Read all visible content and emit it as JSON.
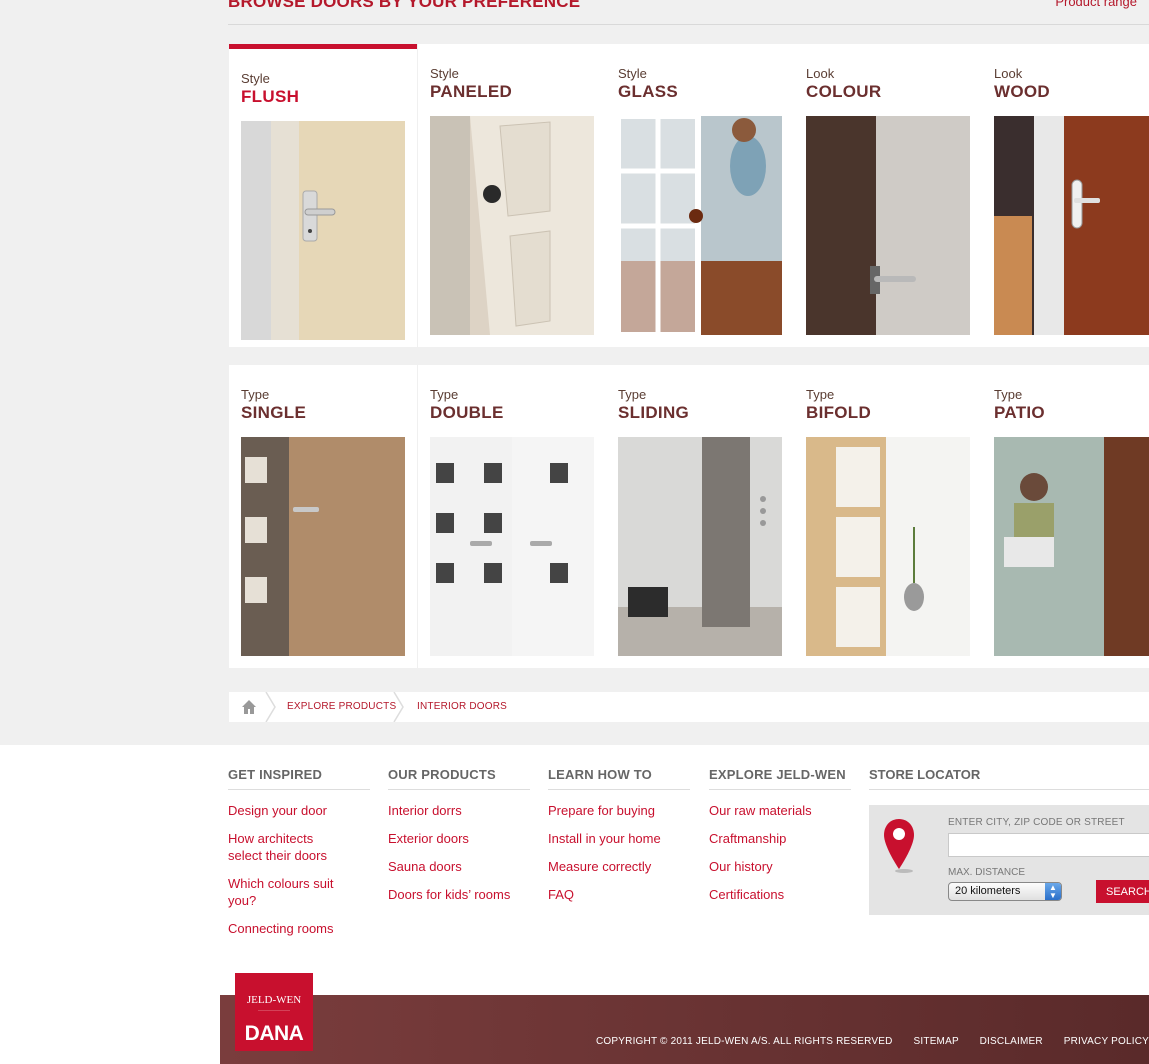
{
  "header": {
    "title": "BROWSE DOORS BY YOUR PREFERENCE",
    "product_range": "Product range"
  },
  "cards": [
    {
      "kicker": "Style",
      "label": "FLUSH"
    },
    {
      "kicker": "Style",
      "label": "PANELED"
    },
    {
      "kicker": "Style",
      "label": "GLASS"
    },
    {
      "kicker": "Look",
      "label": "COLOUR"
    },
    {
      "kicker": "Look",
      "label": "WOOD"
    },
    {
      "kicker": "Type",
      "label": "SINGLE"
    },
    {
      "kicker": "Type",
      "label": "DOUBLE"
    },
    {
      "kicker": "Type",
      "label": "SLIDING"
    },
    {
      "kicker": "Type",
      "label": "BIFOLD"
    },
    {
      "kicker": "Type",
      "label": "PATIO"
    }
  ],
  "breadcrumb": {
    "items": [
      "EXPLORE PRODUCTS",
      "INTERIOR DOORS"
    ]
  },
  "footer": {
    "columns": [
      {
        "title": "GET INSPIRED",
        "links": [
          "Design your door",
          "How architects select their doors",
          "Which colours suit you?",
          "Connecting rooms"
        ]
      },
      {
        "title": "OUR PRODUCTS",
        "links": [
          "Interior dorrs",
          "Exterior doors",
          "Sauna doors",
          "Doors for kids’ rooms"
        ]
      },
      {
        "title": "LEARN HOW TO",
        "links": [
          "Prepare for buying",
          "Install in your home",
          "Measure correctly",
          "FAQ"
        ]
      },
      {
        "title": "EXPLORE JELD-WEN",
        "links": [
          "Our raw materials",
          "Craftmanship",
          "Our history",
          "Certifications"
        ]
      }
    ],
    "store_locator": {
      "title": "STORE LOCATOR",
      "address_label": "ENTER CITY, ZIP CODE OR STREET",
      "address_value": "",
      "distance_label": "MAX. DISTANCE",
      "distance_value": "20 kilometers",
      "search_label": "SEARCH"
    },
    "bottom_links": [
      "COPYRIGHT © 2011 JELD-WEN A/S. ALL RIGHTS RESERVED",
      "SITEMAP",
      "DISCLAIMER",
      "PRIVACY POLICY"
    ]
  },
  "logo": {
    "top": "JELD-WEN",
    "bottom": "DANA"
  },
  "colors": {
    "accent": "#c8102e",
    "brand_dark": "#6b2f2f",
    "page_bg": "#f0f0f0"
  }
}
